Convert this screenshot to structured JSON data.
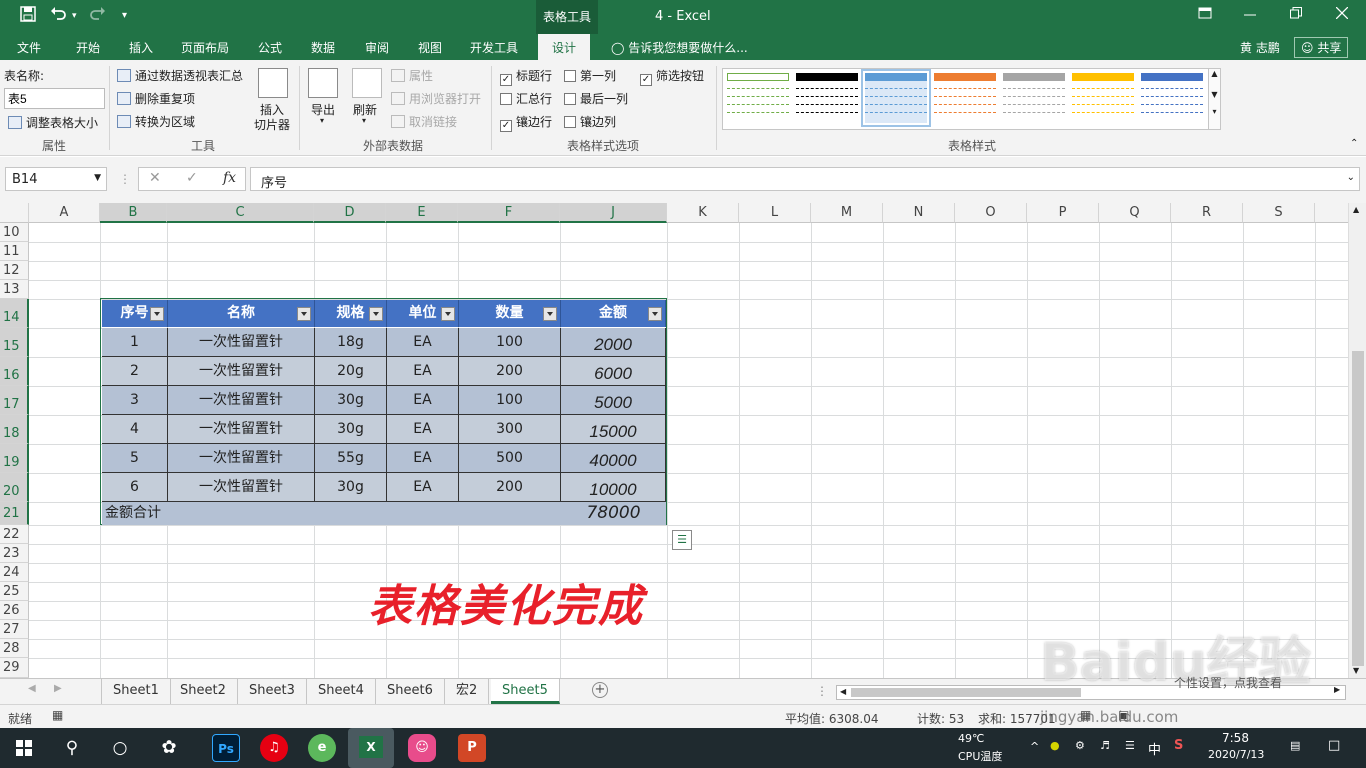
{
  "titlebar": {
    "tool_context": "表格工具",
    "title": "4 - Excel",
    "save_icon": "save-icon",
    "undo_icon": "undo-icon",
    "redo_icon": "redo-icon"
  },
  "tabs": [
    "文件",
    "开始",
    "插入",
    "页面布局",
    "公式",
    "数据",
    "审阅",
    "视图",
    "开发工具",
    "设计"
  ],
  "active_tab": "设计",
  "tell_me": "告诉我您想要做什么...",
  "user": "黄 志鹏",
  "share": "共享",
  "ribbon": {
    "properties": {
      "table_name_label": "表名称:",
      "table_name_value": "表5",
      "resize": "调整表格大小",
      "group": "属性"
    },
    "tools": {
      "pivot": "通过数据透视表汇总",
      "remove_dup": "删除重复项",
      "convert": "转换为区域",
      "slicer_line1": "插入",
      "slicer_line2": "切片器",
      "group": "工具"
    },
    "external": {
      "export": "导出",
      "refresh": "刷新",
      "properties": "属性",
      "open_browser": "用浏览器打开",
      "unlink": "取消链接",
      "group": "外部表数据"
    },
    "style_options": {
      "header_row": "标题行",
      "first_col": "第一列",
      "filter_btn": "筛选按钮",
      "total_row": "汇总行",
      "last_col": "最后一列",
      "banded_rows": "镶边行",
      "banded_cols": "镶边列",
      "group": "表格样式选项"
    },
    "styles": {
      "group": "表格样式",
      "swatches": [
        "#70ad47",
        "#000000",
        "#5b9bd5",
        "#ed7d31",
        "#a5a5a5",
        "#ffc000",
        "#4472c4"
      ]
    }
  },
  "formula_bar": {
    "name_box": "B14",
    "formula": "序号"
  },
  "columns": [
    "A",
    "B",
    "C",
    "D",
    "E",
    "F",
    "J",
    "K",
    "L",
    "M",
    "N",
    "O",
    "P",
    "Q",
    "R",
    "S"
  ],
  "rows": [
    "10",
    "11",
    "12",
    "13",
    "14",
    "15",
    "16",
    "17",
    "18",
    "19",
    "20",
    "21",
    "22",
    "23",
    "24",
    "25",
    "26",
    "27",
    "28",
    "29"
  ],
  "table": {
    "headers": [
      "序号",
      "名称",
      "规格",
      "单位",
      "数量",
      "金额"
    ],
    "rows": [
      [
        "1",
        "一次性留置针",
        "18g",
        "EA",
        "100",
        "2000"
      ],
      [
        "2",
        "一次性留置针",
        "20g",
        "EA",
        "200",
        "6000"
      ],
      [
        "3",
        "一次性留置针",
        "30g",
        "EA",
        "100",
        "5000"
      ],
      [
        "4",
        "一次性留置针",
        "30g",
        "EA",
        "300",
        "15000"
      ],
      [
        "5",
        "一次性留置针",
        "55g",
        "EA",
        "500",
        "40000"
      ],
      [
        "6",
        "一次性留置针",
        "30g",
        "EA",
        "200",
        "10000"
      ]
    ],
    "total_label": "金额合计",
    "total_value": "78000",
    "header_color": "#4472c4"
  },
  "banner": "表格美化完成",
  "sheet_tabs": [
    "Sheet1",
    "Sheet2",
    "Sheet3",
    "Sheet4",
    "Sheet6",
    "宏2",
    "Sheet5"
  ],
  "active_sheet": "Sheet5",
  "status": {
    "ready": "就绪",
    "average": "平均值: 6308.04",
    "count": "计数: 53",
    "sum": "求和: 157701"
  },
  "watermark": {
    "logo": "Baidu经验",
    "sub": "个性设置，点我查看",
    "url": "jingyan.baidu.com"
  },
  "taskbar": {
    "temp": "49℃",
    "cpu": "CPU温度",
    "ime": "中",
    "time": "7:58",
    "date": "2020/7/13"
  }
}
